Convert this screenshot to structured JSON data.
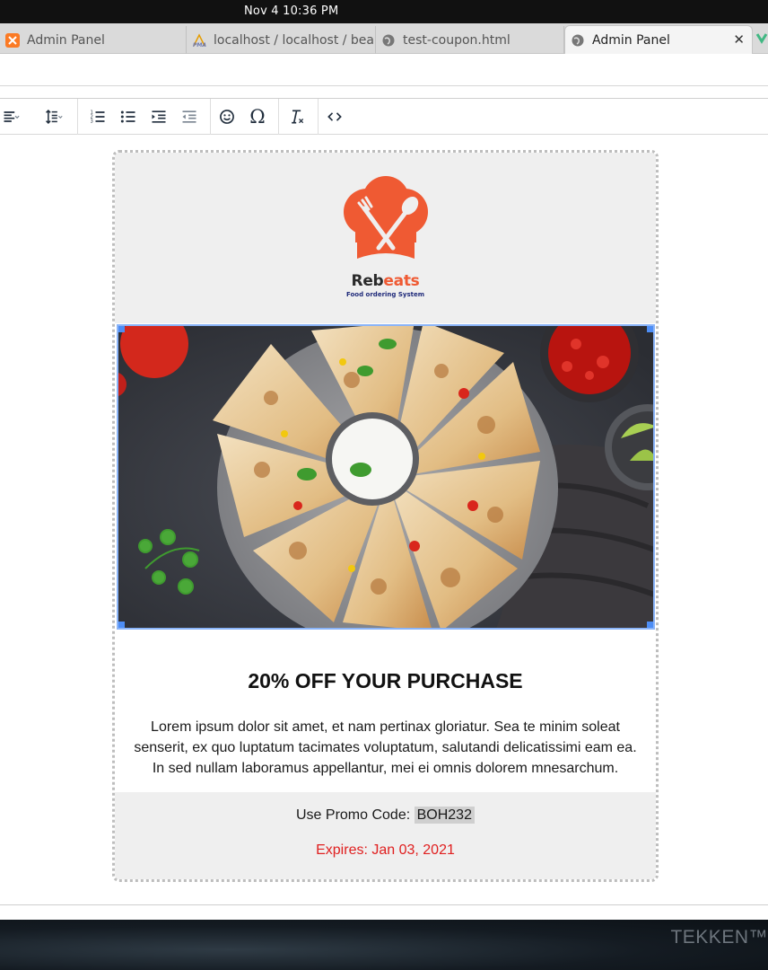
{
  "system": {
    "clock": "Nov 4  10:36 PM"
  },
  "tabs": [
    {
      "label": "Admin Panel",
      "icon": "xampp-icon",
      "active": false
    },
    {
      "label": "localhost / localhost / bea",
      "icon": "phpmyadmin-icon",
      "active": false
    },
    {
      "label": "test-coupon.html",
      "icon": "globe-icon",
      "active": false
    },
    {
      "label": "Admin Panel",
      "icon": "globe-icon",
      "active": true
    }
  ],
  "toolbar": {
    "buttons": [
      "align-icon",
      "line-height-icon",
      "numbered-list-icon",
      "bullet-list-icon",
      "indent-icon",
      "outdent-icon",
      "emoticon-icon",
      "special-char-icon",
      "clear-format-icon",
      "source-code-icon"
    ],
    "special_char": "Ω"
  },
  "email": {
    "brand_part1": "Reb",
    "brand_part2": "eats",
    "tagline": "Food ordering System",
    "title": "20% OFF YOUR PURCHASE",
    "body": "Lorem ipsum dolor sit amet, et nam pertinax gloriatur. Sea te minim soleat senserit, ex quo luptatum tacimates voluptatum, salutandi delicatissimi eam ea. In sed nullam laboramus appellantur, mei ei omnis dolorem mnesarchum.",
    "promo_label": "Use Promo Code: ",
    "promo_code": "BOH232",
    "expires": "Expires: Jan 03, 2021"
  },
  "colors": {
    "brand_orange": "#ef5a33",
    "expires_red": "#e02020",
    "selection_blue": "#4d8df5"
  },
  "background": {
    "watermark": "TEKKEN™"
  }
}
